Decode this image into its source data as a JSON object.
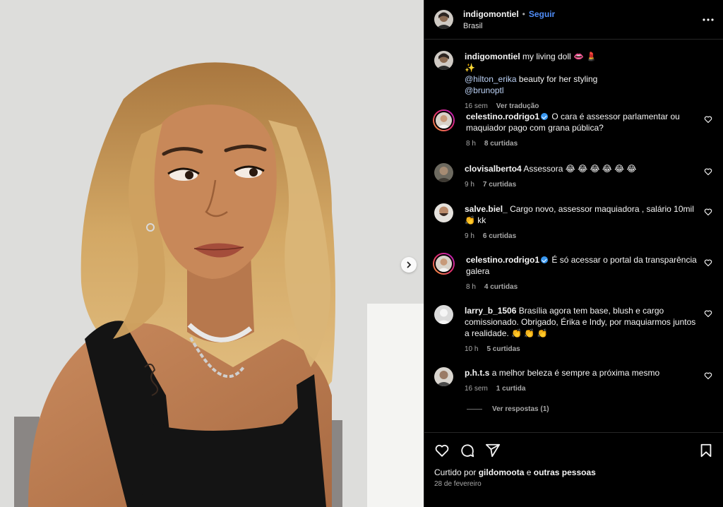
{
  "post": {
    "username": "indigomontiel",
    "separator": "•",
    "follow_label": "Seguir",
    "location": "Brasil"
  },
  "caption": {
    "username": "indigomontiel",
    "text_part1": "my living doll 👄 💄 ✨",
    "mention1": "@hilton_erika",
    "text_part2": "beauty for her styling",
    "mention2": "@brunoptl",
    "time": "16 sem",
    "translate_label": "Ver tradução"
  },
  "comments": [
    {
      "username": "celestino.rodrigo1",
      "verified": true,
      "text": "O cara é assessor parlamentar ou maquiador pago com grana pública?",
      "time": "8 h",
      "likes": "8 curtidas"
    },
    {
      "username": "clovisalberto4",
      "verified": false,
      "text": "Assessora 😂 😂 😂 😂 😂 😂",
      "time": "9 h",
      "likes": "7 curtidas"
    },
    {
      "username": "salve.biel_",
      "verified": false,
      "text": "Cargo novo, assessor maquiadora , salário 10mil 👏 kk",
      "time": "9 h",
      "likes": "6 curtidas"
    },
    {
      "username": "celestino.rodrigo1",
      "verified": true,
      "text": "É só acessar o portal da transparência galera",
      "time": "8 h",
      "likes": "4 curtidas"
    },
    {
      "username": "larry_b_1506",
      "verified": false,
      "text": "Brasília agora tem base, blush e cargo comissionado. Obrigado, Érika e Indy, por maquiarmos juntos a realidade. 👏 👏 👏",
      "time": "10 h",
      "likes": "5 curtidas"
    },
    {
      "username": "p.h.t.s",
      "verified": false,
      "text": "a melhor beleza é sempre a próxima mesmo",
      "time": "16 sem",
      "likes": "1 curtida"
    }
  ],
  "view_replies_label": "Ver respostas (1)",
  "liked_by": {
    "prefix": "Curtido por",
    "user": "gildomoota",
    "middle": "e",
    "suffix": "outras pessoas"
  },
  "post_date": "28 de fevereiro",
  "colors": {
    "background": "#000000",
    "accent_link": "#4f8df8",
    "muted_text": "#a8a8a8",
    "verified": "#3897f0"
  },
  "icons": [
    "more-options-icon",
    "heart-icon",
    "comment-icon",
    "share-icon",
    "bookmark-icon",
    "chevron-right-icon",
    "verified-badge-icon"
  ]
}
